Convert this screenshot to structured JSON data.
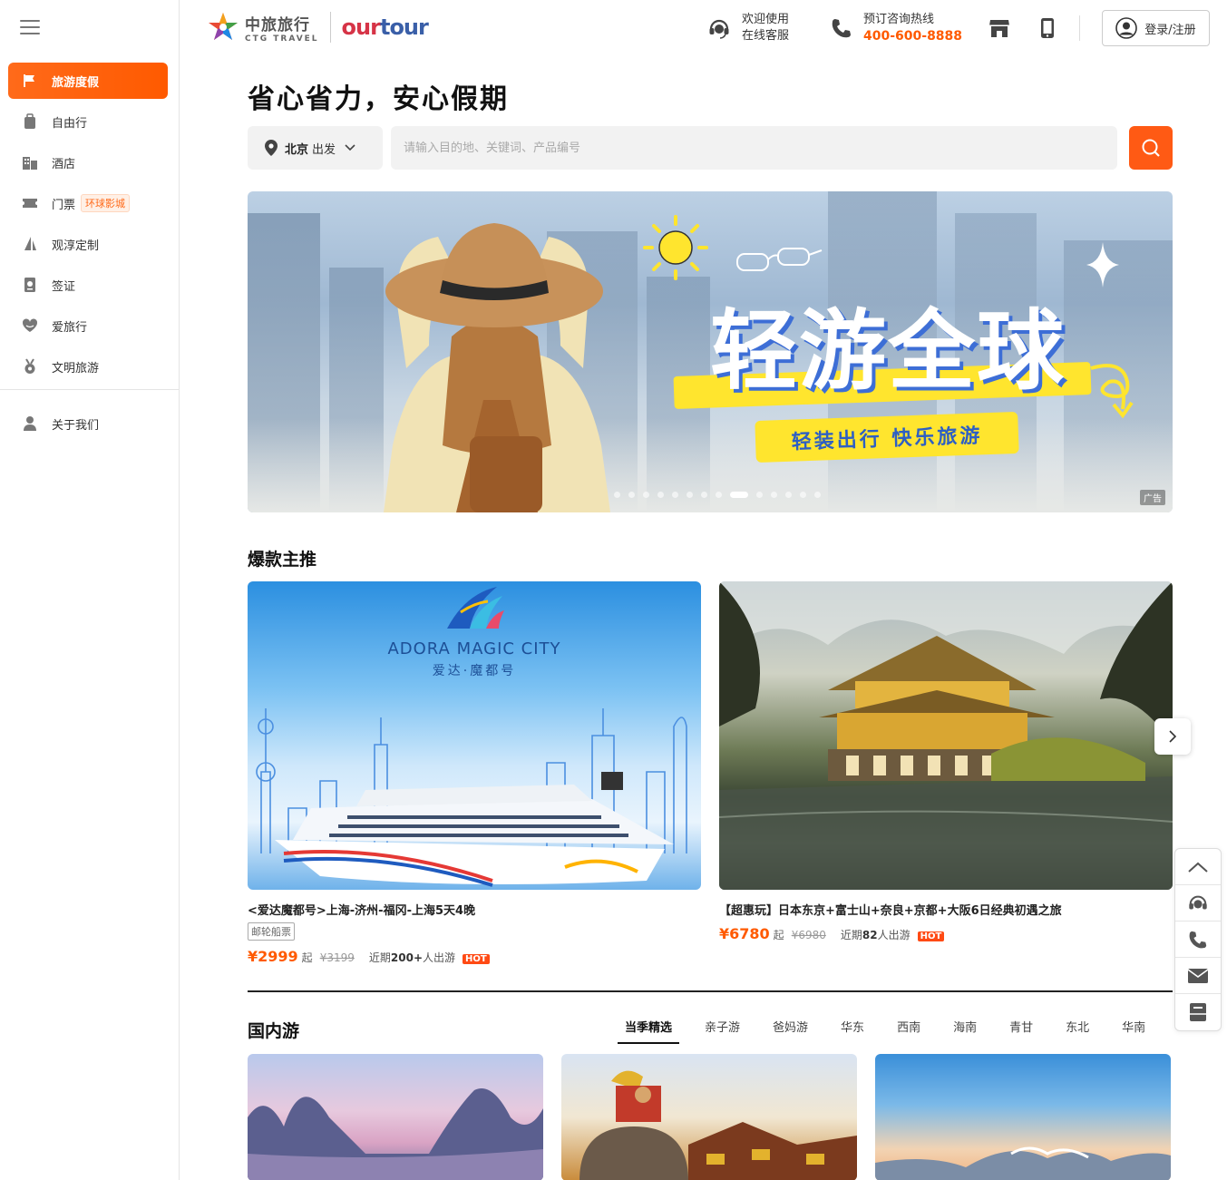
{
  "header": {
    "brand_cn": "中旅旅行",
    "brand_en": "CTG TRAVEL",
    "brand_our": "our",
    "brand_tour": "tour",
    "service_line1": "欢迎使用",
    "service_line2": "在线客服",
    "hotline_label": "预订咨询热线",
    "hotline_number": "400-600-8888",
    "login_label": "登录/注册"
  },
  "sidebar": {
    "items": [
      {
        "label": "旅游度假",
        "icon": "flag-icon"
      },
      {
        "label": "自由行",
        "icon": "luggage-icon"
      },
      {
        "label": "酒店",
        "icon": "hotel-icon"
      },
      {
        "label": "门票",
        "icon": "ticket-icon",
        "badge": "环球影城"
      },
      {
        "label": "观淳定制",
        "icon": "sail-icon"
      },
      {
        "label": "签证",
        "icon": "passport-icon"
      },
      {
        "label": "爱旅行",
        "icon": "heart-icon"
      },
      {
        "label": "文明旅游",
        "icon": "medal-icon"
      }
    ],
    "bottom_item": {
      "label": "关于我们",
      "icon": "user-icon"
    }
  },
  "main": {
    "slogan": "省心省力，安心假期",
    "search": {
      "city": "北京",
      "city_suffix": "出发",
      "placeholder": "请输入目的地、关键词、产品编号"
    },
    "banner": {
      "title": "轻游全球",
      "subtitle": "轻装出行  快乐旅游",
      "ad_tag": "广告",
      "dot_count": 14,
      "active_dot": 8
    },
    "hot_section": {
      "title": "爆款主推",
      "cards": [
        {
          "name": "<爱达魔都号>上海-济州-福冈-上海5天4晚",
          "tag": "邮轮船票",
          "price": "¥2999",
          "qi": "起",
          "orig_price": "¥3199",
          "recent_prefix": "近期",
          "recent_count": "200+",
          "recent_suffix": "人出游",
          "hot": "HOT",
          "ship_brand": "ADORA MAGIC CITY",
          "ship_cn": "爱达·魔都号"
        },
        {
          "name": "【超惠玩】日本东京+富士山+奈良+京都+大阪6日经典初遇之旅",
          "price": "¥6780",
          "qi": "起",
          "orig_price": "¥6980",
          "recent_prefix": "近期",
          "recent_count": "82",
          "recent_suffix": "人出游",
          "hot": "HOT"
        }
      ]
    },
    "domestic": {
      "title": "国内游",
      "tabs": [
        "当季精选",
        "亲子游",
        "爸妈游",
        "华东",
        "西南",
        "海南",
        "青甘",
        "东北",
        "华南"
      ],
      "active_tab": 0
    }
  },
  "float_bar": [
    "arrow-up-icon",
    "headset-icon",
    "phone-icon",
    "mail-icon",
    "feedback-icon"
  ],
  "colors": {
    "accent": "#ff5a14",
    "brand_red": "#d63447",
    "brand_blue": "#3a5fa8"
  }
}
